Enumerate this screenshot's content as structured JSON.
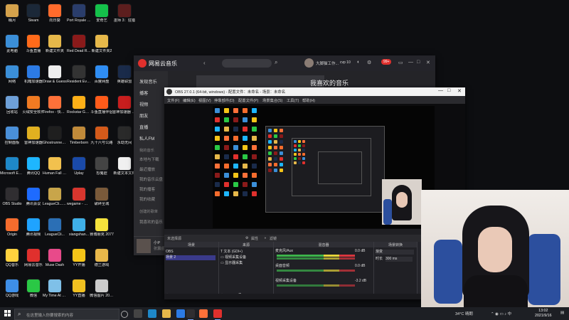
{
  "desktop": {
    "icons": [
      {
        "label": "桶月",
        "color": "#d4a24c",
        "col": 0,
        "row": 0
      },
      {
        "label": "Steam",
        "color": "#1b2838",
        "col": 1,
        "row": 0
      },
      {
        "label": "向日葵",
        "color": "#ff6b2c",
        "col": 2,
        "row": 0
      },
      {
        "label": "Port Royale 4 Soundtr...",
        "color": "#2a3d6b",
        "col": 3,
        "row": 0
      },
      {
        "label": "爱奇艺",
        "color": "#14c14a",
        "col": 4,
        "row": 0
      },
      {
        "label": "巫师 3：狂猎",
        "color": "#5c1e1e",
        "col": 5,
        "row": 0
      },
      {
        "label": "此电脑",
        "color": "#3b8fd8",
        "col": 0,
        "row": 1
      },
      {
        "label": "斗鱼直播",
        "color": "#ff6a1a",
        "col": 1,
        "row": 1
      },
      {
        "label": "新建文件夹",
        "color": "#e6b84a",
        "col": 2,
        "row": 1
      },
      {
        "label": "Red Dead Redempti...",
        "color": "#8a1a1a",
        "col": 3,
        "row": 1
      },
      {
        "label": "新建文件夹2",
        "color": "#e6b84a",
        "col": 4,
        "row": 1
      },
      {
        "label": "网络",
        "color": "#3b8fd8",
        "col": 0,
        "row": 2
      },
      {
        "label": "机箱加速器",
        "color": "#2c7be5",
        "col": 1,
        "row": 2
      },
      {
        "label": "Draw & Guess",
        "color": "#eeeeee",
        "col": 2,
        "row": 2
      },
      {
        "label": "Resident Evil Village",
        "color": "#333333",
        "col": 3,
        "row": 2
      },
      {
        "label": "百度网盘",
        "color": "#2f8df3",
        "col": 4,
        "row": 2
      },
      {
        "label": "英雄联盟",
        "color": "#1a2b4a",
        "col": 5,
        "row": 2
      },
      {
        "label": "回收站",
        "color": "#6ea0d8",
        "col": 0,
        "row": 3
      },
      {
        "label": "火绒安全软件",
        "color": "#f07a22",
        "col": 1,
        "row": 3
      },
      {
        "label": "Firefox - 快捷方式",
        "color": "#ff7139",
        "col": 2,
        "row": 3
      },
      {
        "label": "Rockstar Games...",
        "color": "#fcaf17",
        "col": 3,
        "row": 3
      },
      {
        "label": "斗鱼直播伴侣",
        "color": "#ff5b1a",
        "col": 4,
        "row": 3
      },
      {
        "label": "雷神加速器 WeGame",
        "color": "#c81e1e",
        "col": 5,
        "row": 3
      },
      {
        "label": "控制面板",
        "color": "#4a90d9",
        "col": 0,
        "row": 4
      },
      {
        "label": "雷神加速器",
        "color": "#e0b020",
        "col": 1,
        "row": 4
      },
      {
        "label": "Ghostrunner - 施用中",
        "color": "#1f1f1f",
        "col": 2,
        "row": 4
      },
      {
        "label": "Timberborn",
        "color": "#c08a3a",
        "col": 3,
        "row": 4
      },
      {
        "label": "九十六号公路",
        "color": "#d45a1a",
        "col": 4,
        "row": 4
      },
      {
        "label": "永劫无间",
        "color": "#2a2a2a",
        "col": 5,
        "row": 4
      },
      {
        "label": "Microsoft Edge",
        "color": "#1e88c8",
        "col": 0,
        "row": 5
      },
      {
        "label": "腾讯QQ",
        "color": "#1eb6ff",
        "col": 1,
        "row": 5
      },
      {
        "label": "Human Fall Flat",
        "color": "#f2c14e",
        "col": 2,
        "row": 5
      },
      {
        "label": "Uplay",
        "color": "#1a4aa8",
        "col": 3,
        "row": 5
      },
      {
        "label": "恐鬼症",
        "color": "#444444",
        "col": 4,
        "row": 5
      },
      {
        "label": "新建文本文档",
        "color": "#f0f0f0",
        "col": 5,
        "row": 5
      },
      {
        "label": "OBS Studio",
        "color": "#302e31",
        "col": 0,
        "row": 6
      },
      {
        "label": "腾讯会议",
        "color": "#1e6bff",
        "col": 1,
        "row": 6
      },
      {
        "label": "LeagueCli... - 快捷方式",
        "color": "#c8a54a",
        "col": 2,
        "row": 6
      },
      {
        "label": "wegame - 快捷方式",
        "color": "#d8362e",
        "col": 3,
        "row": 6
      },
      {
        "label": "破碎圣城",
        "color": "#7a5a3a",
        "col": 4,
        "row": 6
      },
      {
        "label": "Origin",
        "color": "#f56c2d",
        "col": 0,
        "row": 7
      },
      {
        "label": "腾讯视频",
        "color": "#1fa3ff",
        "col": 1,
        "row": 7
      },
      {
        "label": "LeagueCli...",
        "color": "#2b6fb5",
        "col": 2,
        "row": 7
      },
      {
        "label": "xiangshan...",
        "color": "#3fb0e8",
        "col": 3,
        "row": 7
      },
      {
        "label": "赛博朋克 2077",
        "color": "#f5e33c",
        "col": 4,
        "row": 7
      },
      {
        "label": "QQ音乐",
        "color": "#ffd23e",
        "col": 0,
        "row": 8
      },
      {
        "label": "网易云音乐",
        "color": "#e0302d",
        "col": 1,
        "row": 8
      },
      {
        "label": "Muse Dash",
        "color": "#e84a8a",
        "col": 2,
        "row": 8
      },
      {
        "label": "YY开播",
        "color": "#f5c518",
        "col": 3,
        "row": 8
      },
      {
        "label": "德兰游戏",
        "color": "#e8b84a",
        "col": 4,
        "row": 8
      },
      {
        "label": "QQ游戏",
        "color": "#3e8fe8",
        "col": 0,
        "row": 9
      },
      {
        "label": "微信",
        "color": "#2ac845",
        "col": 1,
        "row": 9
      },
      {
        "label": "My Time At Portia",
        "color": "#7fc0e8",
        "col": 2,
        "row": 9
      },
      {
        "label": "YY直播",
        "color": "#f0c020",
        "col": 3,
        "row": 9
      },
      {
        "label": "微信图片 2020091...",
        "color": "#cccccc",
        "col": 4,
        "row": 9
      }
    ]
  },
  "netease": {
    "title": "网易云音乐",
    "back": "‹",
    "mic": "⌕",
    "user": "大脚猫工作...",
    "vip": "cvp 10",
    "badge": "99+",
    "nav": [
      "发现音乐",
      "播客",
      "视频",
      "朋友",
      "直播",
      "私人FM"
    ],
    "section_mine": "我的音乐",
    "sub_items": [
      "本地与下载",
      "最近播放",
      "我的音乐云盘",
      "我的播客",
      "我的收藏"
    ],
    "section_created": "创建的歌单",
    "section_collected": "我喜欢的音乐",
    "playlist_title": "我喜欢的音乐",
    "now_playing": "小P",
    "now_sub": "张震岳"
  },
  "obs": {
    "title": "OBS 27.0.1 (64-bit, windows) - 配置文件：未命名 - 场景：未命名",
    "menu": [
      "文件(F)",
      "编辑(E)",
      "视图(V)",
      "停靠部件(D)",
      "配置文件(P)",
      "场景集合(S)",
      "工具(T)",
      "帮助(H)"
    ],
    "source_bar": [
      "未选择源",
      "属性",
      "滤镜"
    ],
    "docks": {
      "scenes": {
        "title": "场景",
        "items": [
          "OBS",
          "场景 2"
        ]
      },
      "sources": {
        "title": "来源",
        "items": [
          "文本 (GDI+)",
          "视频采集设备",
          "显示器采集"
        ]
      },
      "mixer": {
        "title": "混音器",
        "items": [
          "麦克风/Aux",
          "桌面音频",
          "视频采集设备"
        ],
        "levels": [
          "0.0 dB",
          "0.0 dB",
          "-3.2 dB"
        ]
      },
      "transitions": {
        "title": "场景转换",
        "mode": "渐变",
        "duration_label": "时长",
        "duration": "300 ms"
      }
    },
    "status": "LIVE: 00:00:00  REC: 00:00:00  CPU: 2.1%, 30.00 fps"
  },
  "taskbar": {
    "search_placeholder": "在这里输入你要搜索的内容",
    "weather": "34°C 晴朗",
    "time": "13:02",
    "date": "2021/9/16"
  }
}
